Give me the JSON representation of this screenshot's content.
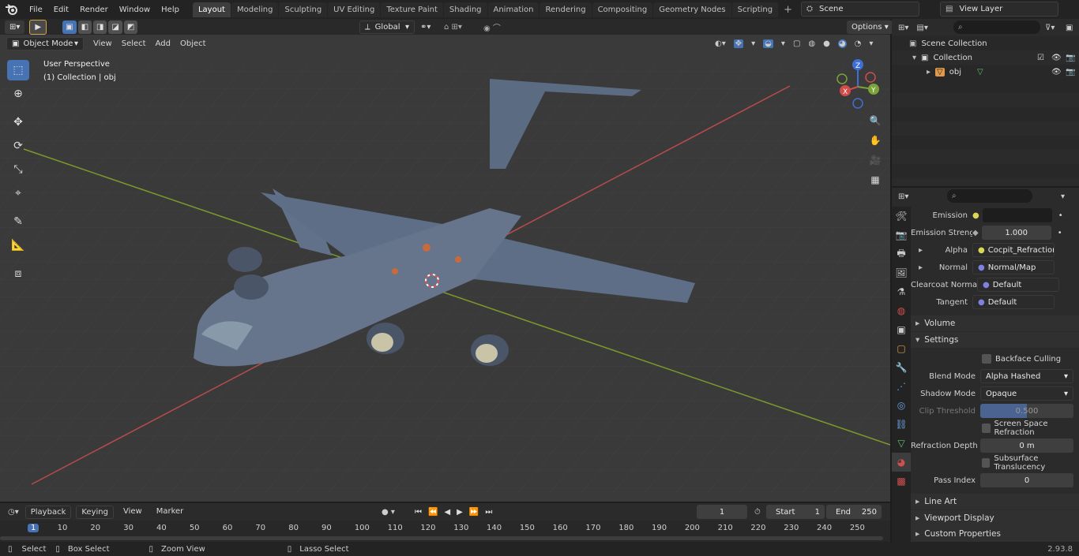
{
  "menus": [
    "File",
    "Edit",
    "Render",
    "Window",
    "Help"
  ],
  "workspaces": [
    "Layout",
    "Modeling",
    "Sculpting",
    "UV Editing",
    "Texture Paint",
    "Shading",
    "Animation",
    "Rendering",
    "Compositing",
    "Geometry Nodes",
    "Scripting"
  ],
  "active_workspace": "Layout",
  "scene": "Scene",
  "view_layer": "View Layer",
  "viewport": {
    "mode": "Object Mode",
    "menus": [
      "View",
      "Select",
      "Add",
      "Object"
    ],
    "transform": "Global",
    "options": "Options",
    "perspective": "User Perspective",
    "collection_info": "(1) Collection | obj",
    "gizmo": {
      "z": "Z",
      "y": "Y",
      "x": "X"
    }
  },
  "outliner": {
    "root": "Scene Collection",
    "collection": "Collection",
    "object": "obj"
  },
  "properties": {
    "rows": [
      {
        "label": "Emission",
        "value": "",
        "kind": "color"
      },
      {
        "label": "Emission Strengt",
        "value": "1.000",
        "kind": "number"
      },
      {
        "label": "Alpha",
        "value": "Cocpit_Refraction_in...",
        "kind": "link"
      },
      {
        "label": "Normal",
        "value": "Normal/Map",
        "kind": "link"
      },
      {
        "label": "Clearcoat Normal",
        "value": "Default",
        "kind": "link"
      },
      {
        "label": "Tangent",
        "value": "Default",
        "kind": "link"
      }
    ],
    "sections": {
      "volume": "Volume",
      "settings": "Settings",
      "line_art": "Line Art",
      "viewport_display": "Viewport Display",
      "custom_properties": "Custom Properties"
    },
    "settings": {
      "backface_culling": "Backface Culling",
      "blend_mode_label": "Blend Mode",
      "blend_mode": "Alpha Hashed",
      "shadow_mode_label": "Shadow Mode",
      "shadow_mode": "Opaque",
      "clip_threshold_label": "Clip Threshold",
      "clip_threshold": "0.500",
      "ssr": "Screen Space Refraction",
      "refraction_depth_label": "Refraction Depth",
      "refraction_depth": "0 m",
      "subsurface": "Subsurface Translucency",
      "pass_index_label": "Pass Index",
      "pass_index": "0"
    }
  },
  "timeline": {
    "menus": [
      "Playback",
      "Keying",
      "View",
      "Marker"
    ],
    "current_frame": "1",
    "start_label": "Start",
    "start": "1",
    "end_label": "End",
    "end": "250",
    "ruler": [
      "1",
      "10",
      "20",
      "30",
      "40",
      "50",
      "60",
      "70",
      "80",
      "90",
      "100",
      "110",
      "120",
      "130",
      "140",
      "150",
      "160",
      "170",
      "180",
      "190",
      "200",
      "210",
      "220",
      "230",
      "240",
      "250"
    ]
  },
  "status": {
    "select": "Select",
    "box_select": "Box Select",
    "zoom_view": "Zoom View",
    "lasso_select": "Lasso Select",
    "version": "2.93.8"
  }
}
